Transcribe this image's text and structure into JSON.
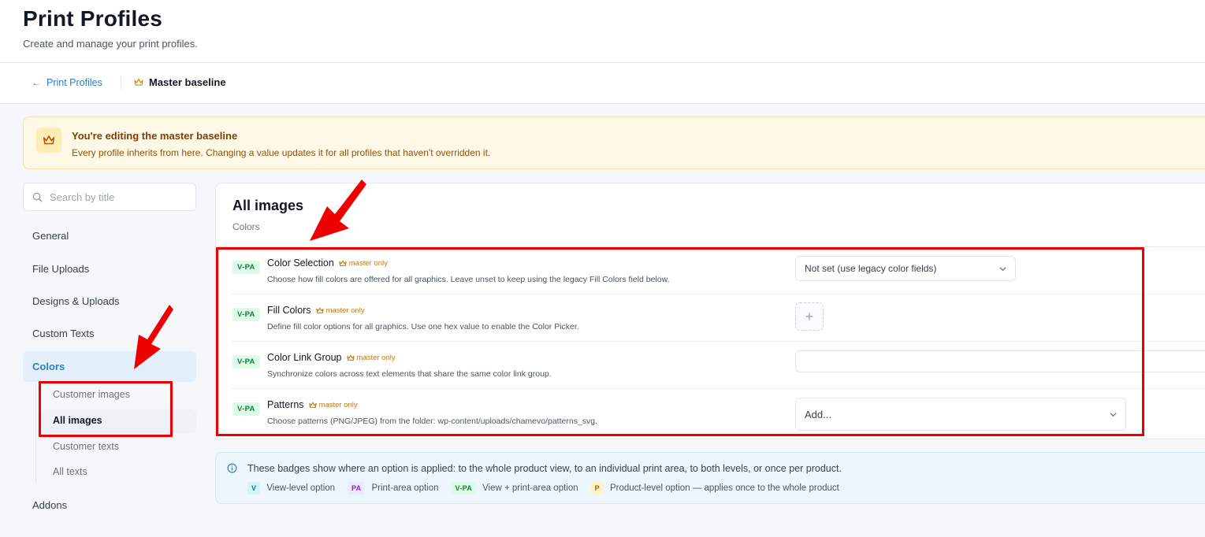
{
  "header": {
    "title": "Print Profiles",
    "subtitle": "Create and manage your print profiles."
  },
  "breadcrumb": {
    "back_label": "Print Profiles",
    "current_label": "Master baseline"
  },
  "banner": {
    "title": "You're editing the master baseline",
    "text": "Every profile inherits from here. Changing a value updates it for all profiles that haven't overridden it."
  },
  "sidebar": {
    "search_placeholder": "Search by title",
    "items": [
      {
        "label": "General"
      },
      {
        "label": "File Uploads"
      },
      {
        "label": "Designs & Uploads"
      },
      {
        "label": "Custom Texts"
      },
      {
        "label": "Colors",
        "active": true
      },
      {
        "label": "Addons"
      }
    ],
    "sub_items": [
      {
        "label": "Customer images"
      },
      {
        "label": "All images",
        "active": true
      },
      {
        "label": "Customer texts"
      },
      {
        "label": "All texts"
      }
    ]
  },
  "panel": {
    "title": "All images",
    "subtitle": "Colors",
    "master_tag": "master only",
    "rows": [
      {
        "badge": "V-PA",
        "title": "Color Selection",
        "description": "Choose how fill colors are offered for all graphics. Leave unset to keep using the legacy Fill Colors field below.",
        "control_value": "Not set (use legacy color fields)"
      },
      {
        "badge": "V-PA",
        "title": "Fill Colors",
        "description": "Define fill color options for all graphics. Use one hex value to enable the Color Picker."
      },
      {
        "badge": "V-PA",
        "title": "Color Link Group",
        "description": "Synchronize colors across text elements that share the same color link group."
      },
      {
        "badge": "V-PA",
        "title": "Patterns",
        "description": "Choose patterns (PNG/JPEG) from the folder: wp-content/uploads/chamevo/patterns_svg.",
        "control_value": "Add..."
      }
    ]
  },
  "info": {
    "text": "These badges show where an option is applied: to the whole product view, to an individual print area, to both levels, or once per product.",
    "legend": [
      {
        "badge": "V",
        "label": "View-level option"
      },
      {
        "badge": "PA",
        "label": "Print-area option"
      },
      {
        "badge": "V-PA",
        "label": "View + print-area option"
      },
      {
        "badge": "P",
        "label": "Product-level option — applies once to the whole product"
      }
    ]
  },
  "colors": {
    "accent": "#2e7ec9",
    "annotation_red": "#ee0000",
    "master_orange": "#c77a12",
    "banner_bg": "#fef9e7"
  }
}
